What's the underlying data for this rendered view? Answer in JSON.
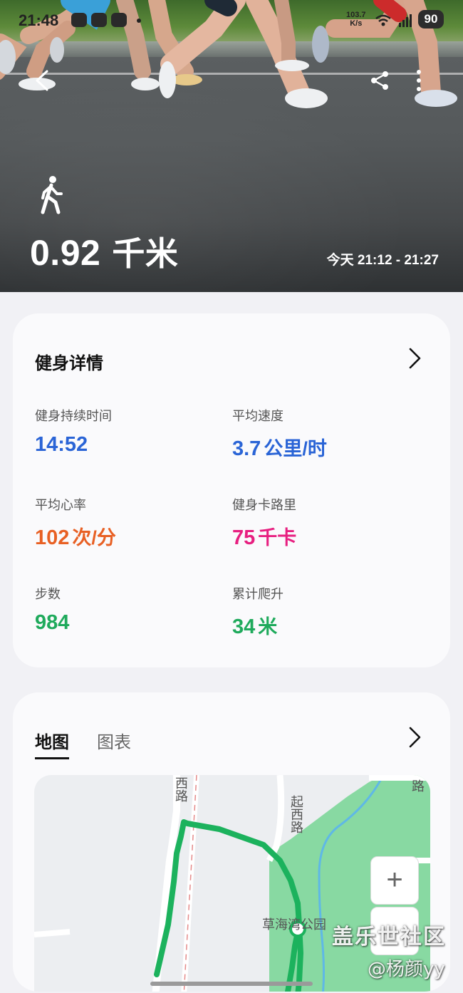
{
  "status_bar": {
    "time": "21:48",
    "net_speed_value": "103.7",
    "net_speed_unit": "K/s",
    "battery": "90"
  },
  "hero": {
    "distance_value": "0.92",
    "distance_unit": "千米",
    "time_range": "今天 21:12 - 21:27"
  },
  "details": {
    "title": "健身详情",
    "metrics": [
      {
        "label": "健身持续时间",
        "value": "14:52",
        "unit": "",
        "color": "#2a64d6"
      },
      {
        "label": "平均速度",
        "value": "3.7",
        "unit": "公里/时",
        "color": "#2a64d6"
      },
      {
        "label": "平均心率",
        "value": "102",
        "unit": "次/分",
        "color": "#e86024"
      },
      {
        "label": "健身卡路里",
        "value": "75",
        "unit": "千卡",
        "color": "#e71f80"
      },
      {
        "label": "步数",
        "value": "984",
        "unit": "",
        "color": "#1faa5c"
      },
      {
        "label": "累计爬升",
        "value": "34",
        "unit": "米",
        "color": "#1faa5c"
      }
    ]
  },
  "map_card": {
    "tabs": [
      "地图",
      "图表"
    ],
    "active_tab": "地图",
    "map_labels": {
      "road_west": "西路",
      "road_qixi": "起西路",
      "park": "草海湾公园",
      "road_corner": "路"
    },
    "zoom_in": "+"
  },
  "watermark": {
    "title": "盖乐世社区",
    "author": "@杨颜yy"
  },
  "icons": {
    "back": "back-arrow-icon",
    "share": "share-icon",
    "more": "more-vertical-icon",
    "activity": "walking-icon",
    "chevron": "chevron-right-icon"
  }
}
